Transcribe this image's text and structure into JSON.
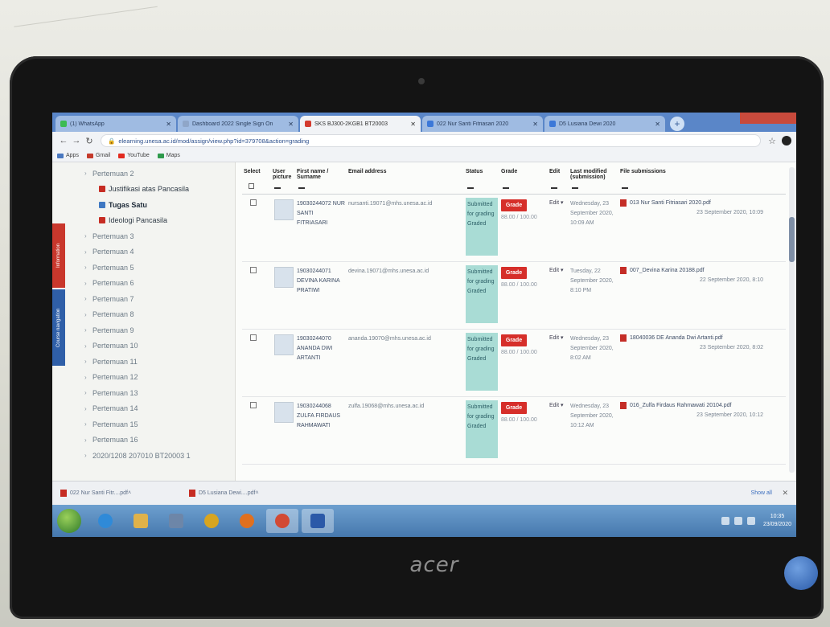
{
  "colors": {
    "grade_button": "#d62f2a",
    "status_submitted": "#a9dcd5",
    "taskbar": "#4678ad",
    "tab_strip": "#5a86c8"
  },
  "browser": {
    "tabs": [
      {
        "title": "(1) WhatsApp",
        "icon": "whatsapp-icon",
        "active": false
      },
      {
        "title": "Dashboard 2022 Single Sign On",
        "icon": "page-icon",
        "active": false
      },
      {
        "title": "SKS BJ300-2KGB1 BT20003",
        "icon": "moodle-icon",
        "active": true
      },
      {
        "title": "022 Nur Santi Fitriasari 2020",
        "icon": "chrome-icon",
        "active": false
      },
      {
        "title": "D5 Lusiana Dewi 2020",
        "icon": "chrome-icon",
        "active": false
      }
    ],
    "url": "elearning.unesa.ac.id/mod/assign/view.php?id=379708&action=grading",
    "bookmarks": [
      {
        "label": "Apps",
        "icon": "apps-icon"
      },
      {
        "label": "Gmail",
        "icon": "gmail-icon"
      },
      {
        "label": "YouTube",
        "icon": "youtube-icon"
      },
      {
        "label": "Maps",
        "icon": "maps-icon"
      }
    ]
  },
  "sidebar": {
    "items": [
      {
        "label": "Pertemuan 2",
        "type": "section"
      },
      {
        "label": "Justifikasi atas Pancasila",
        "type": "activity",
        "icon": "pdf-icon"
      },
      {
        "label": "Tugas Satu",
        "type": "activity",
        "icon": "assignment-icon",
        "current": true
      },
      {
        "label": "Ideologi Pancasila",
        "type": "activity",
        "icon": "pdf-icon"
      },
      {
        "label": "Pertemuan 3",
        "type": "section"
      },
      {
        "label": "Pertemuan 4",
        "type": "section"
      },
      {
        "label": "Pertemuan 5",
        "type": "section"
      },
      {
        "label": "Pertemuan 6",
        "type": "section"
      },
      {
        "label": "Pertemuan 7",
        "type": "section"
      },
      {
        "label": "Pertemuan 8",
        "type": "section"
      },
      {
        "label": "Pertemuan 9",
        "type": "section"
      },
      {
        "label": "Pertemuan 10",
        "type": "section"
      },
      {
        "label": "Pertemuan 11",
        "type": "section"
      },
      {
        "label": "Pertemuan 12",
        "type": "section"
      },
      {
        "label": "Pertemuan 13",
        "type": "section"
      },
      {
        "label": "Pertemuan 14",
        "type": "section"
      },
      {
        "label": "Pertemuan 15",
        "type": "section"
      },
      {
        "label": "Pertemuan 16",
        "type": "section"
      },
      {
        "label": "2020/1208 207010 BT20003 1",
        "type": "section"
      }
    ]
  },
  "grading": {
    "headers": {
      "select": "Select",
      "picture": "User picture",
      "name": "First name / Surname",
      "email": "Email address",
      "status": "Status",
      "grade": "Grade",
      "edit": "Edit",
      "modified": "Last modified (submission)",
      "files": "File submissions"
    },
    "rows": [
      {
        "name": "19030244072 NUR SANTI FITRIASARI",
        "email": "nursanti.19071@mhs.unesa.ac.id",
        "status": "Submitted for grading Graded",
        "grade_label": "Grade",
        "grade_value": "88.00 / 100.00",
        "edit": "Edit",
        "modified": "Wednesday, 23 September 2020, 10:09 AM",
        "file": "013 Nur Santi Fitriasari 2020.pdf",
        "file_date": "23 September 2020, 10:09"
      },
      {
        "name": "19030244071 DEVINA KARINA PRATIWI",
        "email": "devina.19071@mhs.unesa.ac.id",
        "status": "Submitted for grading Graded",
        "grade_label": "Grade",
        "grade_value": "88.00 / 100.00",
        "edit": "Edit",
        "modified": "Tuesday, 22 September 2020, 8:10 PM",
        "file": "007_Devina Karina 20188.pdf",
        "file_date": "22 September 2020, 8:10"
      },
      {
        "name": "19030244070 ANANDA DWI ARTANTI",
        "email": "ananda.19070@mhs.unesa.ac.id",
        "status": "Submitted for grading Graded",
        "grade_label": "Grade",
        "grade_value": "88.00 / 100.00",
        "edit": "Edit",
        "modified": "Wednesday, 23 September 2020, 8:02 AM",
        "file": "18040036 DE Ananda Dwi Artanti.pdf",
        "file_date": "23 September 2020, 8:02"
      },
      {
        "name": "19030244068 ZULFA FIRDAUS RAHMAWATI",
        "email": "zulfa.19068@mhs.unesa.ac.id",
        "status": "Submitted for grading Graded",
        "grade_label": "Grade",
        "grade_value": "88.00 / 100.00",
        "edit": "Edit",
        "modified": "Wednesday, 23 September 2020, 10:12 AM",
        "file": "016_Zulfa Firdaus Rahmawati 20104.pdf",
        "file_date": "23 September 2020, 10:12"
      }
    ]
  },
  "side_tabs": {
    "red": "Information",
    "blue": "Course navigation"
  },
  "downloads": {
    "items": [
      {
        "label": "022 Nur Santi Fitr....pdf"
      },
      {
        "label": "D5 Lusiana Dewi....pdf"
      }
    ],
    "show_all": "Show all"
  },
  "taskbar": {
    "apps": [
      "ie-icon",
      "explorer-icon",
      "media-icon",
      "chrome-icon",
      "firefox-icon",
      "chrome-active-icon",
      "word-icon"
    ],
    "time": "10:35",
    "date": "23/09/2020"
  },
  "laptop": {
    "brand": "acer"
  }
}
